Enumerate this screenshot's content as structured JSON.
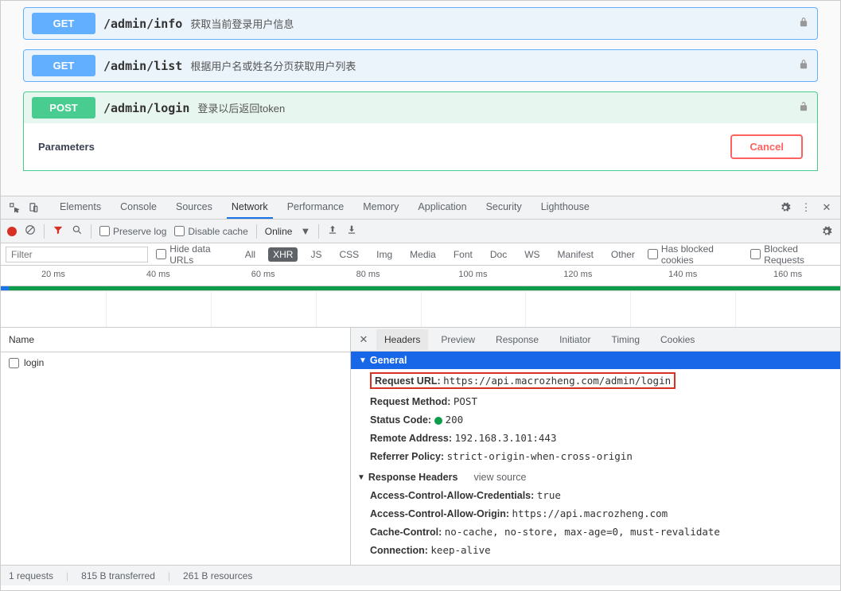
{
  "swagger": {
    "endpoints": [
      {
        "method": "GET",
        "path": "/admin/info",
        "desc": "获取当前登录用户信息"
      },
      {
        "method": "GET",
        "path": "/admin/list",
        "desc": "根据用户名或姓名分页获取用户列表"
      },
      {
        "method": "POST",
        "path": "/admin/login",
        "desc": "登录以后返回token"
      }
    ],
    "params_label": "Parameters",
    "cancel_label": "Cancel"
  },
  "devtools": {
    "tabs": [
      "Elements",
      "Console",
      "Sources",
      "Network",
      "Performance",
      "Memory",
      "Application",
      "Security",
      "Lighthouse"
    ],
    "active_tab": "Network"
  },
  "net_toolbar": {
    "preserve_log": "Preserve log",
    "disable_cache": "Disable cache",
    "online": "Online"
  },
  "filter_row": {
    "placeholder": "Filter",
    "hide_data_urls": "Hide data URLs",
    "pills": [
      "All",
      "XHR",
      "JS",
      "CSS",
      "Img",
      "Media",
      "Font",
      "Doc",
      "WS",
      "Manifest",
      "Other"
    ],
    "active_pill": "XHR",
    "has_blocked": "Has blocked cookies",
    "blocked_req": "Blocked Requests"
  },
  "timeline": [
    "20 ms",
    "40 ms",
    "60 ms",
    "80 ms",
    "100 ms",
    "120 ms",
    "140 ms",
    "160 ms"
  ],
  "requests": {
    "header": "Name",
    "items": [
      "login"
    ]
  },
  "detail": {
    "tabs": [
      "Headers",
      "Preview",
      "Response",
      "Initiator",
      "Timing",
      "Cookies"
    ],
    "active_tab": "Headers",
    "general_label": "General",
    "general": {
      "request_url_k": "Request URL:",
      "request_url_v": "https://api.macrozheng.com/admin/login",
      "request_method_k": "Request Method:",
      "request_method_v": "POST",
      "status_k": "Status Code:",
      "status_v": "200",
      "remote_k": "Remote Address:",
      "remote_v": "192.168.3.101:443",
      "referrer_k": "Referrer Policy:",
      "referrer_v": "strict-origin-when-cross-origin"
    },
    "response_headers_label": "Response Headers",
    "view_source": "view source",
    "response_headers": [
      {
        "k": "Access-Control-Allow-Credentials:",
        "v": "true"
      },
      {
        "k": "Access-Control-Allow-Origin:",
        "v": "https://api.macrozheng.com"
      },
      {
        "k": "Cache-Control:",
        "v": "no-cache, no-store, max-age=0, must-revalidate"
      },
      {
        "k": "Connection:",
        "v": "keep-alive"
      }
    ]
  },
  "status": {
    "requests": "1 requests",
    "transferred": "815 B transferred",
    "resources": "261 B resources"
  }
}
